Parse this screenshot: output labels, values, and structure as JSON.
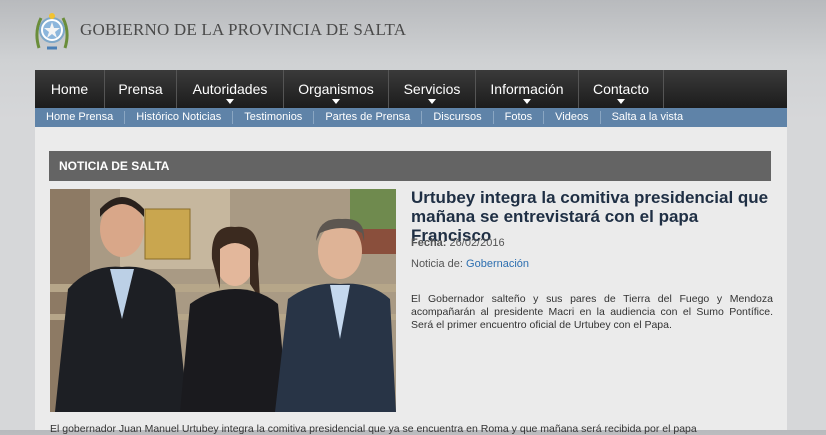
{
  "header": {
    "site_title": "GOBIERNO DE LA PROVINCIA DE SALTA"
  },
  "nav": {
    "items": [
      {
        "label": "Home"
      },
      {
        "label": "Prensa"
      },
      {
        "label": "Autoridades"
      },
      {
        "label": "Organismos"
      },
      {
        "label": "Servicios"
      },
      {
        "label": "Información"
      },
      {
        "label": "Contacto"
      }
    ]
  },
  "subnav": {
    "items": [
      "Home Prensa",
      "Histórico Noticias",
      "Testimonios",
      "Partes de Prensa",
      "Discursos",
      "Fotos",
      "Videos",
      "Salta a la vista"
    ]
  },
  "section": {
    "title": "NOTICIA DE SALTA"
  },
  "article": {
    "headline": "Urtubey integra la comitiva presidencial que mañana se entrevistará con el papa Francisco",
    "date_label": "Fecha:",
    "date": "26/02/2016",
    "category_label": "Noticia de:",
    "category": "Gobernación",
    "summary": "El Gobernador salteño y sus pares de Tierra del Fuego y Mendoza acompañarán al presidente Macri en la audiencia con el Sumo Pontífice. Será el primer encuentro oficial de Urtubey con el Papa.",
    "body_start": "El gobernador Juan Manuel Urtubey integra la comitiva presidencial que ya se encuentra en Roma y que mañana será recibida por el papa"
  },
  "colors": {
    "nav_bg": "#1c1c1c",
    "subnav_bg": "#5f83a8",
    "section_bar": "#646464",
    "link": "#2d6fb0",
    "headline": "#1f2f44"
  }
}
